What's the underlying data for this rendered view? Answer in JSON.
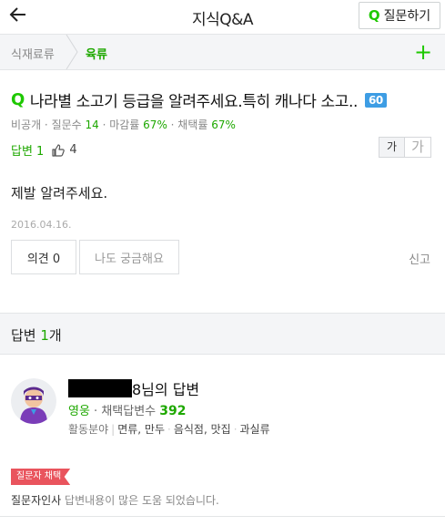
{
  "header": {
    "title": "지식Q&A",
    "ask_button_q": "Q",
    "ask_button_label": "질문하기"
  },
  "breadcrumb": {
    "category": "식재료류",
    "subcategory": "육류",
    "add_symbol": "+"
  },
  "question": {
    "q_mark": "Q",
    "title": "나라별 소고기 등급을 알려주세요.특히 캐나다 소고..",
    "score_badge": "60",
    "meta_prefix": "비공개 · 질문수 ",
    "question_count": "14",
    "deadline_label": " · 마감률 ",
    "deadline_rate": "67%",
    "adopt_label": " · 채택률 ",
    "adopt_rate": "67%",
    "answer_label": "답변 1",
    "like_count": "4",
    "font_small": "가",
    "font_large": "가",
    "body": "제발 알려주세요.",
    "date": "2016.04.16.",
    "opinion_button": "의견 0",
    "curious_button": "나도 궁금해요",
    "report": "신고"
  },
  "answers": {
    "header_prefix": "답변 ",
    "count": "1",
    "header_suffix": "개"
  },
  "answer": {
    "user_suffix": "8님의 답변",
    "grade": "영웅",
    "adopted_label": " · 채택답변수 ",
    "adopted_count": "392",
    "field_label": "활동분야",
    "fields": [
      "면류, 만두",
      "음식점, 맛집",
      "과실류"
    ],
    "badge": "질문자 채택",
    "thanks_label": "질문자인사",
    "thanks_message": "답변내용이 많은 도움 되었습니다."
  },
  "colors": {
    "accent_green": "#1ec800",
    "score_blue": "#3d9de4",
    "badge_red": "#e9545d"
  }
}
